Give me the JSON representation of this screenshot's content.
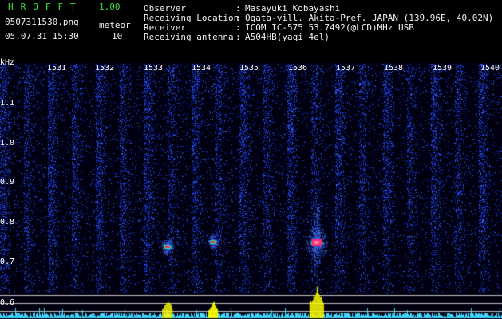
{
  "header": {
    "app_title": "HROFFT",
    "app_version": "1.00",
    "file_name": "0507311530.png",
    "mode_label": "meteor",
    "date_time": "05.07.31 15:30",
    "count_value": "10",
    "info": [
      {
        "key": "Observer",
        "value": "Masayuki Kobayashi"
      },
      {
        "key": "Receiving Location",
        "value": "Ogata-vill. Akita-Pref. JAPAN (139.96E, 40.02N)"
      },
      {
        "key": "Receiver",
        "value": "ICOM IC-575 53.7492(@LCD)MHz USB"
      },
      {
        "key": "Receiving antenna",
        "value": "A504HB(yagi 4el)"
      }
    ]
  },
  "spectrogram": {
    "freq_unit": "kHz",
    "y_ticks": [
      "1.1",
      "1.0",
      "0.9",
      "0.8",
      "0.7",
      "0.6"
    ],
    "time_ticks": [
      "1531",
      "1532",
      "1533",
      "1534",
      "1535",
      "1536",
      "1537",
      "1538",
      "1539",
      "1540"
    ],
    "colors": {
      "background": "#000010",
      "noise": "#1530c8",
      "streak": "#2a4cff",
      "echo": "#ff2a6a",
      "echo_edge": "#20e080",
      "meter": "#ffff00",
      "meter_noise": "#40d8ff"
    },
    "echoes": [
      {
        "minute": 1533.3,
        "freq_khz": 0.74,
        "strength": 0.5
      },
      {
        "minute": 1534.25,
        "freq_khz": 0.752,
        "strength": 0.4
      },
      {
        "minute": 1536.4,
        "freq_khz": 0.75,
        "strength": 1.0
      }
    ]
  }
}
